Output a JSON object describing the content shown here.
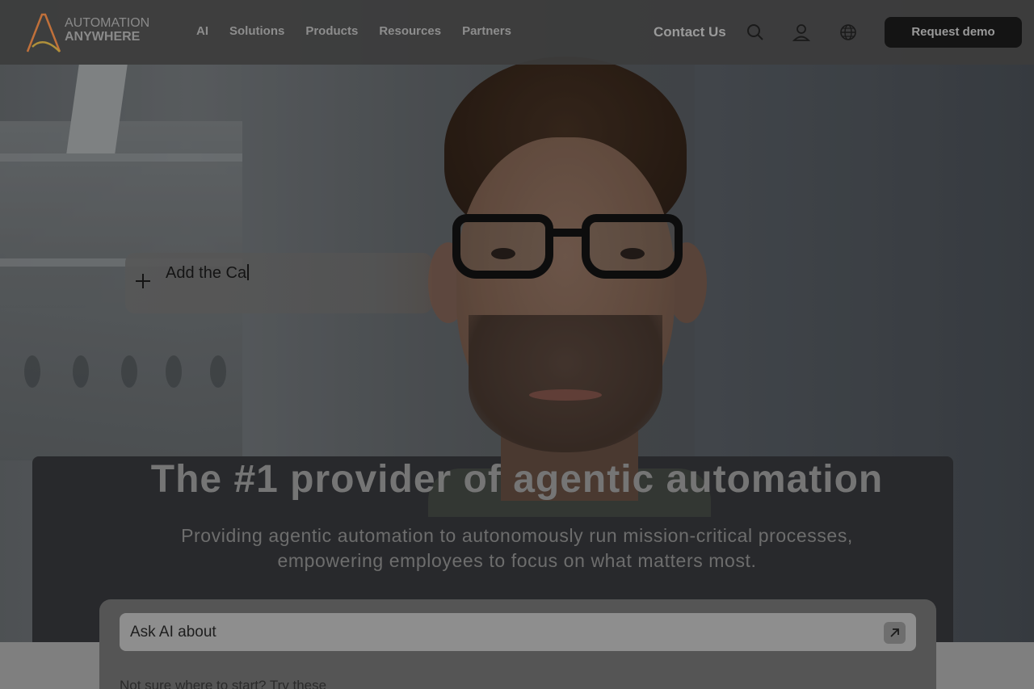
{
  "header": {
    "logo": {
      "line1": "AUTOMATION",
      "line2": "ANYWHERE"
    },
    "nav": [
      "AI",
      "Solutions",
      "Products",
      "Resources",
      "Partners"
    ],
    "contact": "Contact Us",
    "icons": [
      "search-icon",
      "user-icon",
      "globe-icon"
    ],
    "demo_button": "Request demo"
  },
  "hero": {
    "prompt_card": {
      "typed_text": "Add the Ca"
    },
    "headline": "The #1 provider of agentic automation",
    "subline": "Providing agentic automation to autonomously run mission-critical processes, empowering employees to focus on what matters most."
  },
  "ai_panel": {
    "input_label": "Ask AI about",
    "try_text": "Not sure where to start? Try these"
  },
  "colors": {
    "logo_accent": "#c0703a",
    "header_bg": "#3c3c3c"
  }
}
